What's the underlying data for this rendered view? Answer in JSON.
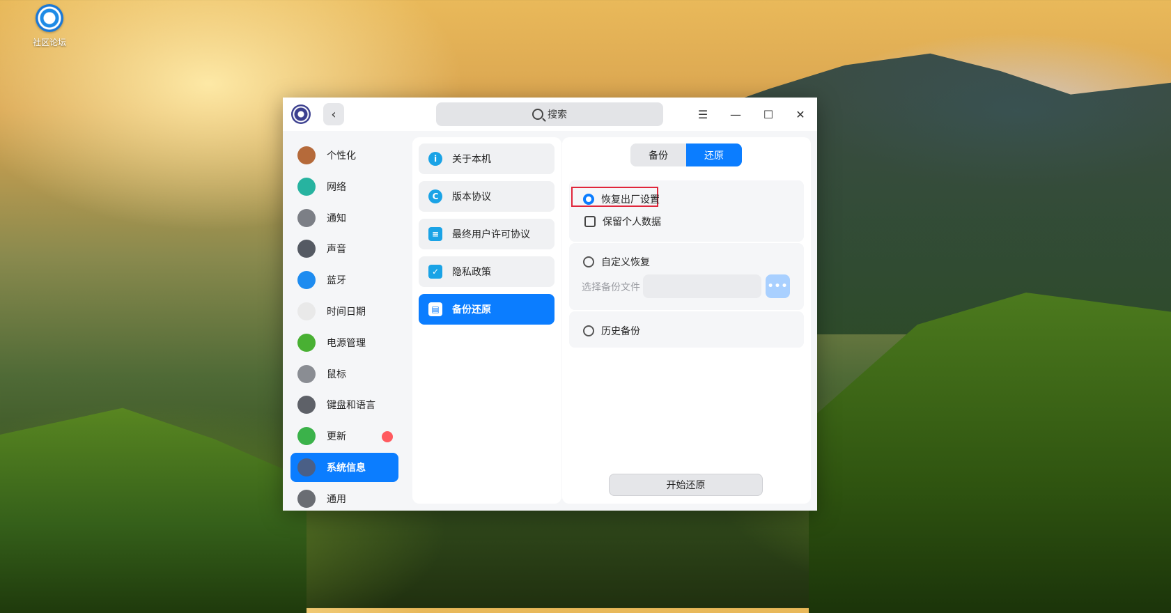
{
  "desktop": {
    "icon_label": "社区论坛"
  },
  "window": {
    "search_placeholder": "搜索",
    "sidebar": {
      "items": [
        {
          "label": "个性化",
          "icon": "personalization-icon",
          "color": "#b56a3a"
        },
        {
          "label": "网络",
          "icon": "network-icon",
          "color": "#27b3a0"
        },
        {
          "label": "通知",
          "icon": "notification-bell-icon",
          "color": "#7c7f86"
        },
        {
          "label": "声音",
          "icon": "speaker-icon",
          "color": "#555a63"
        },
        {
          "label": "蓝牙",
          "icon": "bluetooth-icon",
          "color": "#1e8cf0"
        },
        {
          "label": "时间日期",
          "icon": "clock-icon",
          "color": "#e9e9e9"
        },
        {
          "label": "电源管理",
          "icon": "battery-icon",
          "color": "#49b033"
        },
        {
          "label": "鼠标",
          "icon": "mouse-icon",
          "color": "#8a8d93"
        },
        {
          "label": "键盘和语言",
          "icon": "keyboard-icon",
          "color": "#5e6168"
        },
        {
          "label": "更新",
          "icon": "update-arrow-icon",
          "color": "#3bb24a"
        },
        {
          "label": "系统信息",
          "icon": "system-info-icon",
          "color": "#4a5f86"
        },
        {
          "label": "通用",
          "icon": "general-settings-icon",
          "color": "#6a6d73"
        }
      ],
      "active_index": 10,
      "update_badge_color": "#ff5a5f"
    },
    "middle": {
      "items": [
        {
          "label": "关于本机",
          "icon": "info-icon",
          "glyph": "i",
          "color": "#1aa3e6"
        },
        {
          "label": "版本协议",
          "icon": "copyright-icon",
          "glyph": "C",
          "color": "#1aa3e6"
        },
        {
          "label": "最终用户许可协议",
          "icon": "document-list-icon",
          "glyph": "≡",
          "color": "#1aa3e6"
        },
        {
          "label": "隐私政策",
          "icon": "privacy-document-icon",
          "glyph": "✓",
          "color": "#1aa3e6"
        },
        {
          "label": "备份还原",
          "icon": "backup-restore-icon",
          "glyph": "▤",
          "color": "#ffffff"
        }
      ],
      "active_index": 4
    },
    "restore": {
      "tabs": [
        "备份",
        "还原"
      ],
      "active_tab": 1,
      "factory_reset_label": "恢复出厂设置",
      "keep_personal_data_label": "保留个人数据",
      "custom_restore_label": "自定义恢复",
      "select_backup_file_label": "选择备份文件",
      "more_button_label": "•••",
      "history_backup_label": "历史备份",
      "start_button_label": "开始还原"
    },
    "accent_color": "#0b7dff"
  }
}
